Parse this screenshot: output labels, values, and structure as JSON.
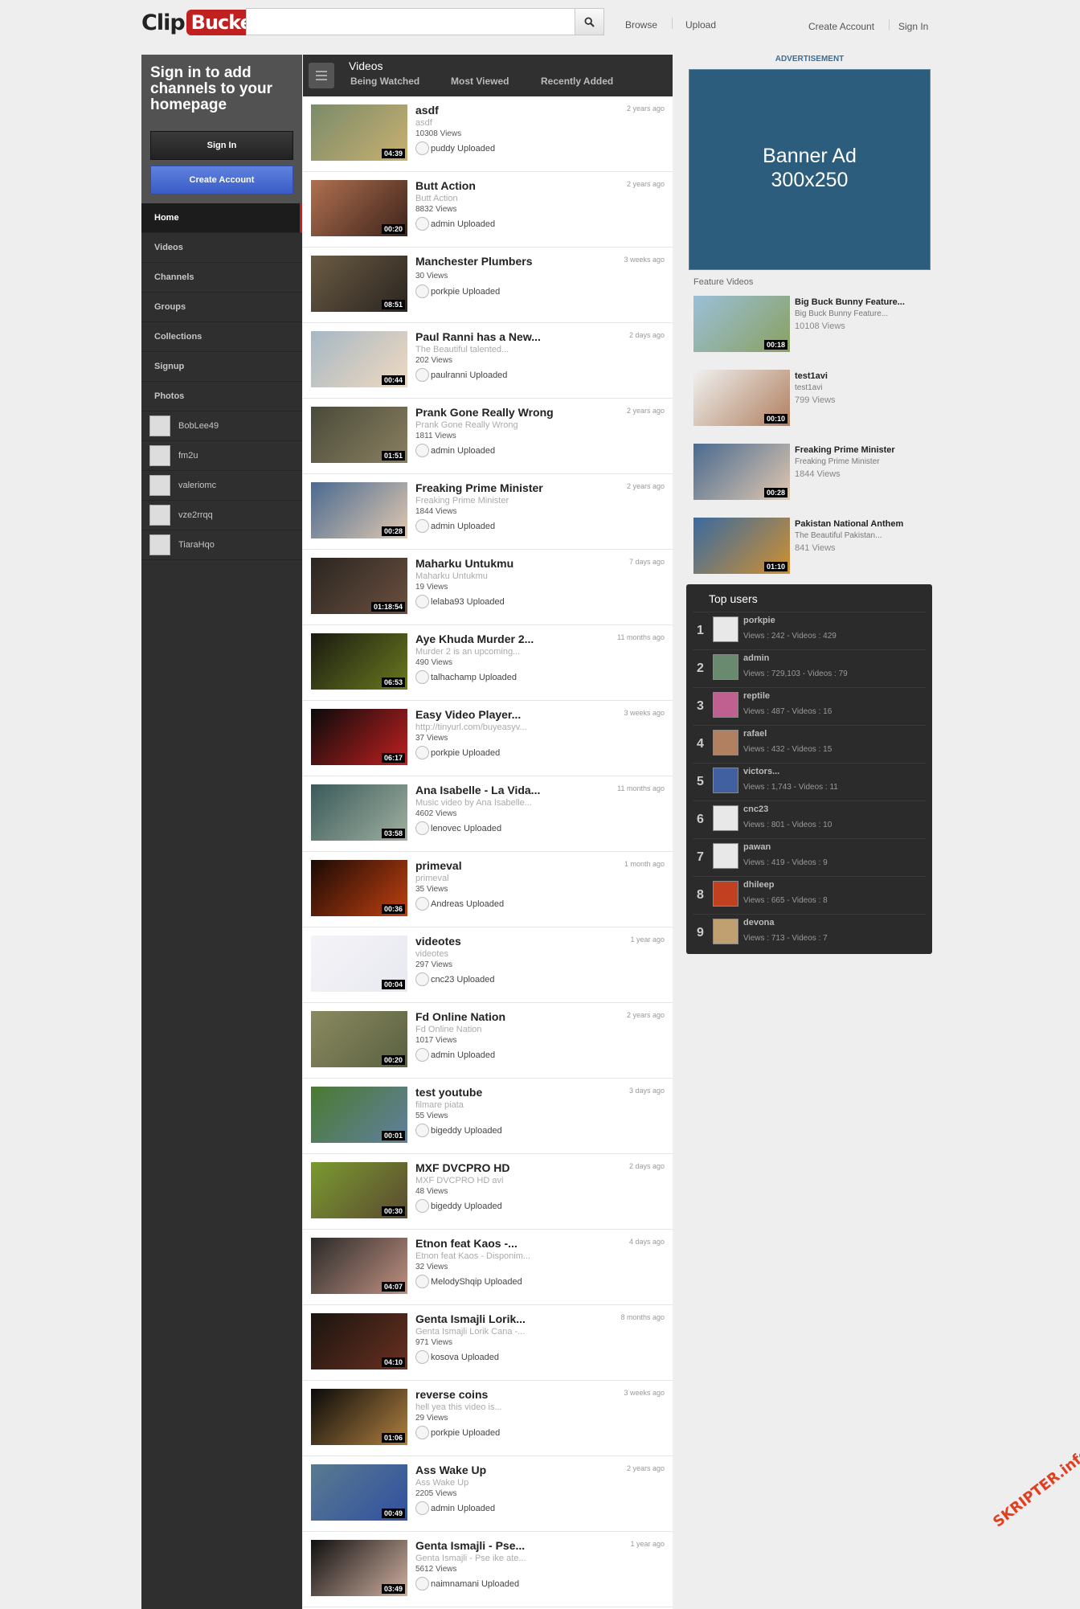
{
  "header": {
    "logo_clip": "Clip",
    "logo_bucket": "Bucket",
    "search_placeholder": "",
    "browse": "Browse",
    "upload": "Upload",
    "create_account": "Create Account",
    "sign_in": "Sign In"
  },
  "sidebar": {
    "prompt": "Sign in to add channels to your homepage",
    "sign_in_button": "Sign In",
    "create_account_button": "Create Account",
    "nav": [
      "Home",
      "Videos",
      "Channels",
      "Groups",
      "Collections",
      "Signup",
      "Photos"
    ],
    "users": [
      "BobLee49",
      "fm2u",
      "valeriomc",
      "vze2rrqq",
      "TiaraHqo"
    ]
  },
  "videos_panel": {
    "title": "Videos",
    "tabs": [
      "Being Watched",
      "Most Viewed",
      "Recently Added"
    ],
    "items": [
      {
        "title": "asdf",
        "desc": "asdf",
        "views": "10308 Views",
        "user": "puddy",
        "uploaded": "Uploaded",
        "age": "2 years ago",
        "duration": "04:39",
        "c1": "#7a8b6a",
        "c2": "#c9b070"
      },
      {
        "title": "Butt Action",
        "desc": "Butt Action",
        "views": "8832 Views",
        "user": "admin",
        "uploaded": "Uploaded",
        "age": "2 years ago",
        "duration": "00:20",
        "c1": "#b07050",
        "c2": "#3d241a"
      },
      {
        "title": "Manchester Plumbers",
        "desc": "",
        "views": "30 Views",
        "user": "porkpie",
        "uploaded": "Uploaded",
        "age": "3 weeks ago",
        "duration": "08:51",
        "c1": "#6b5b43",
        "c2": "#2a2520"
      },
      {
        "title": "Paul Ranni has a New...",
        "desc": "The Beautiful talented...",
        "views": "202 Views",
        "user": "paulranni",
        "uploaded": "Uploaded",
        "age": "2 days ago",
        "duration": "00:44",
        "c1": "#a5b8c4",
        "c2": "#f0d9c0"
      },
      {
        "title": "Prank Gone Really Wrong",
        "desc": "Prank Gone Really Wrong",
        "views": "1811 Views",
        "user": "admin",
        "uploaded": "Uploaded",
        "age": "2 years ago",
        "duration": "01:51",
        "c1": "#4a4a3a",
        "c2": "#8a8060"
      },
      {
        "title": "Freaking Prime Minister",
        "desc": "Freaking Prime Minister",
        "views": "1844 Views",
        "user": "admin",
        "uploaded": "Uploaded",
        "age": "2 years ago",
        "duration": "00:28",
        "c1": "#4a6a90",
        "c2": "#e0c8b0"
      },
      {
        "title": "Maharku Untukmu",
        "desc": "Maharku Untukmu",
        "views": "19 Views",
        "user": "lelaba93",
        "uploaded": "Uploaded",
        "age": "7 days ago",
        "duration": "01:18:54",
        "c1": "#2a2520",
        "c2": "#6b5040"
      },
      {
        "title": "Aye Khuda Murder 2...",
        "desc": "Murder 2 is an upcoming...",
        "views": "490 Views",
        "user": "talhachamp",
        "uploaded": "Uploaded",
        "age": "11 months ago",
        "duration": "06:53",
        "c1": "#1a1a10",
        "c2": "#6a7a20"
      },
      {
        "title": "Easy Video Player...",
        "desc": "http://tinyurl.com/buyeasyv...",
        "views": "37 Views",
        "user": "porkpie",
        "uploaded": "Uploaded",
        "age": "3 weeks ago",
        "duration": "06:17",
        "c1": "#0a0a0a",
        "c2": "#c02020"
      },
      {
        "title": "Ana Isabelle - La Vida...",
        "desc": "Music video by Ana Isabelle...",
        "views": "4602 Views",
        "user": "lenovec",
        "uploaded": "Uploaded",
        "age": "11 months ago",
        "duration": "03:58",
        "c1": "#3a5a5a",
        "c2": "#a0b0a0"
      },
      {
        "title": "primeval",
        "desc": "primeval",
        "views": "35 Views",
        "user": "Andreas",
        "uploaded": "Uploaded",
        "age": "1 month ago",
        "duration": "00:36",
        "c1": "#1a0a05",
        "c2": "#c04010"
      },
      {
        "title": "videotes",
        "desc": "videotes",
        "views": "297 Views",
        "user": "cnc23",
        "uploaded": "Uploaded",
        "age": "1 year ago",
        "duration": "00:04",
        "c1": "#f4f4f8",
        "c2": "#e8e8f0"
      },
      {
        "title": "Fd Online Nation",
        "desc": "Fd Online Nation",
        "views": "1017 Views",
        "user": "admin",
        "uploaded": "Uploaded",
        "age": "2 years ago",
        "duration": "00:20",
        "c1": "#8a8a60",
        "c2": "#5a6040"
      },
      {
        "title": "test youtube",
        "desc": "filmare piata",
        "views": "55 Views",
        "user": "bigeddy",
        "uploaded": "Uploaded",
        "age": "3 days ago",
        "duration": "00:01",
        "c1": "#4a7a30",
        "c2": "#6080a0"
      },
      {
        "title": "MXF DVCPRO HD",
        "desc": "MXF DVCPRO HD avi",
        "views": "48 Views",
        "user": "bigeddy",
        "uploaded": "Uploaded",
        "age": "2 days ago",
        "duration": "00:30",
        "c1": "#7a9a30",
        "c2": "#5a4a30"
      },
      {
        "title": "Etnon feat Kaos -...",
        "desc": "Etnon feat Kaos - Disponim...",
        "views": "32 Views",
        "user": "MelodyShqip",
        "uploaded": "Uploaded",
        "age": "4 days ago",
        "duration": "04:07",
        "c1": "#2a2a2a",
        "c2": "#c09080"
      },
      {
        "title": "Genta Ismajli Lorik...",
        "desc": "Genta Ismajli Lorik Cana -...",
        "views": "971 Views",
        "user": "kosova",
        "uploaded": "Uploaded",
        "age": "8 months ago",
        "duration": "04:10",
        "c1": "#1a1410",
        "c2": "#6a3020"
      },
      {
        "title": "reverse coins",
        "desc": "hell yea this video is...",
        "views": "29 Views",
        "user": "porkpie",
        "uploaded": "Uploaded",
        "age": "3 weeks ago",
        "duration": "01:06",
        "c1": "#0a0a0a",
        "c2": "#b08040"
      },
      {
        "title": "Ass Wake Up",
        "desc": "Ass Wake Up",
        "views": "2205 Views",
        "user": "admin",
        "uploaded": "Uploaded",
        "age": "2 years ago",
        "duration": "00:49",
        "c1": "#5a7a90",
        "c2": "#3050a0"
      },
      {
        "title": "Genta Ismajli - Pse...",
        "desc": "Genta Ismajli - Pse ike ate...",
        "views": "5612 Views",
        "user": "naimnamani",
        "uploaded": "Uploaded",
        "age": "1 year ago",
        "duration": "03:49",
        "c1": "#101010",
        "c2": "#d0b0a0"
      }
    ]
  },
  "advertisement": {
    "label": "ADVERTISEMENT",
    "text_line1": "Banner Ad",
    "text_line2": "300x250"
  },
  "feature_videos": {
    "title": "Feature Videos",
    "items": [
      {
        "title": "Big Buck Bunny Feature...",
        "desc": "Big Buck Bunny Feature...",
        "views": "10108 Views",
        "duration": "00:18",
        "c1": "#9ac0d8",
        "c2": "#8aa060"
      },
      {
        "title": "test1avi",
        "desc": "test1avi",
        "views": "799 Views",
        "duration": "00:10",
        "c1": "#f0f0f0",
        "c2": "#b08060"
      },
      {
        "title": "Freaking Prime Minister",
        "desc": "Freaking Prime Minister",
        "views": "1844 Views",
        "duration": "00:28",
        "c1": "#4a6a90",
        "c2": "#e0c8b0"
      },
      {
        "title": "Pakistan National Anthem",
        "desc": "The Beautiful Pakistan...",
        "views": "841 Views",
        "duration": "01:10",
        "c1": "#3a6aa0",
        "c2": "#d09030"
      }
    ]
  },
  "top_users": {
    "title": "Top users",
    "items": [
      {
        "rank": "1",
        "name": "porkpie",
        "stats": "Views : 242 - Videos : 429",
        "color": "#e8e8e8"
      },
      {
        "rank": "2",
        "name": "admin",
        "stats": "Views : 729,103 - Videos : 79",
        "color": "#6a8a70"
      },
      {
        "rank": "3",
        "name": "reptile",
        "stats": "Views : 487 - Videos : 16",
        "color": "#c06090"
      },
      {
        "rank": "4",
        "name": "rafael",
        "stats": "Views : 432 - Videos : 15",
        "color": "#b08060"
      },
      {
        "rank": "5",
        "name": "victors...",
        "stats": "Views : 1,743 - Videos : 11",
        "color": "#4060a0"
      },
      {
        "rank": "6",
        "name": "cnc23",
        "stats": "Views : 801 - Videos : 10",
        "color": "#e8e8e8"
      },
      {
        "rank": "7",
        "name": "pawan",
        "stats": "Views : 419 - Videos : 9",
        "color": "#e8e8e8"
      },
      {
        "rank": "8",
        "name": "dhileep",
        "stats": "Views : 665 - Videos : 8",
        "color": "#c04020"
      },
      {
        "rank": "9",
        "name": "devona",
        "stats": "Views : 713 - Videos : 7",
        "color": "#c0a070"
      }
    ]
  },
  "watermark": "SKRIPTER.info"
}
